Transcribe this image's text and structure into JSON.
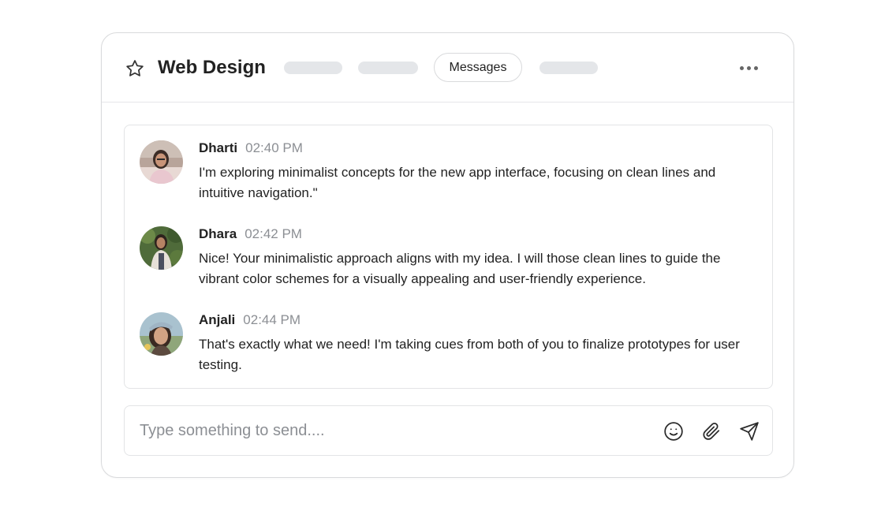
{
  "header": {
    "title": "Web Design",
    "active_tab_label": "Messages",
    "icons": {
      "favorite": "star-icon",
      "more": "more-horizontal-icon"
    }
  },
  "messages": [
    {
      "author": "Dharti",
      "time": "02:40 PM",
      "text": "I'm exploring minimalist concepts for the new app interface, focusing on clean lines and intuitive navigation.\""
    },
    {
      "author": "Dhara",
      "time": "02:42 PM",
      "text": "Nice! Your minimalistic approach aligns with my idea. I will those clean lines to guide the vibrant color schemes for a visually appealing and user-friendly experience."
    },
    {
      "author": "Anjali",
      "time": "02:44 PM",
      "text": "That's exactly what we need! I'm taking cues from both of you to finalize prototypes for user testing."
    }
  ],
  "composer": {
    "placeholder": "Type something to send....",
    "value": "",
    "icons": {
      "emoji": "smile-icon",
      "attach": "paperclip-icon",
      "send": "send-icon"
    }
  },
  "colors": {
    "border": "#d9dadc",
    "placeholder_pill": "#e4e6e9",
    "muted_text": "#8c8f94",
    "text": "#222222"
  }
}
